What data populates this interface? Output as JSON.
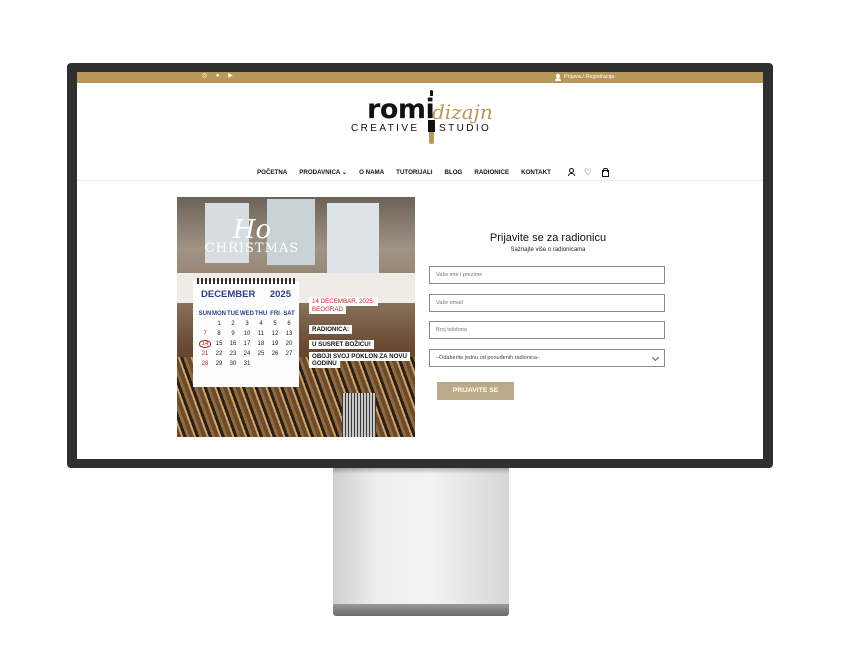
{
  "topbar": {
    "social": [
      "instagram-icon",
      "facebook-icon",
      "youtube-icon"
    ],
    "account_link": "Prijava / Registracija",
    "bg_color": "#b8975a"
  },
  "logo": {
    "romi": "romi",
    "dizajn": "dizajn",
    "creative": "CREATIVE",
    "studio": "STUDIO"
  },
  "nav": {
    "items": [
      "POČETNA",
      "PRODAVNICA ⌄",
      "O NAMA",
      "TUTORIJALI",
      "BLOG",
      "RADIONICE",
      "KONTAKT"
    ],
    "icons": [
      "user-icon",
      "heart-icon",
      "bag-icon"
    ]
  },
  "hero": {
    "script_title": "Ho",
    "subtitle": "CHRISTMAS",
    "calendar": {
      "month": "DECEMBER",
      "year": "2025",
      "weekdays": [
        "SUN",
        "MON",
        "TUE",
        "WED",
        "THU",
        "FRI",
        "SAT"
      ],
      "weeks": [
        [
          "",
          "1",
          "2",
          "3",
          "4",
          "5",
          "6"
        ],
        [
          "7",
          "8",
          "9",
          "10",
          "11",
          "12",
          "13"
        ],
        [
          "14",
          "15",
          "16",
          "17",
          "18",
          "19",
          "20"
        ],
        [
          "21",
          "22",
          "23",
          "24",
          "25",
          "26",
          "27"
        ],
        [
          "28",
          "29",
          "30",
          "31",
          "",
          "",
          ""
        ]
      ],
      "highlight_day": "14"
    },
    "callouts": {
      "date": "14 DECEMBAR, 2025:",
      "city": "BEOGRAD",
      "radionica": "RADIONICA:",
      "susret": "U SUSRET BOŽIĆU!",
      "oboji": "OBOJI SVOJ POKLON ZA NOVU",
      "godinu": "GODINU"
    }
  },
  "form": {
    "title": "Prijavite se za radionicu",
    "subtitle": "Saznajte više o radionicama",
    "name_placeholder": "Vaše ime i prezime",
    "email_placeholder": "Vaše email",
    "phone_placeholder": "Broj telefona",
    "select_value": "–Odaberite jednu od ponuđenih radionica–",
    "submit_label": "PRIJAVITE SE",
    "accent_color": "#bba989"
  }
}
